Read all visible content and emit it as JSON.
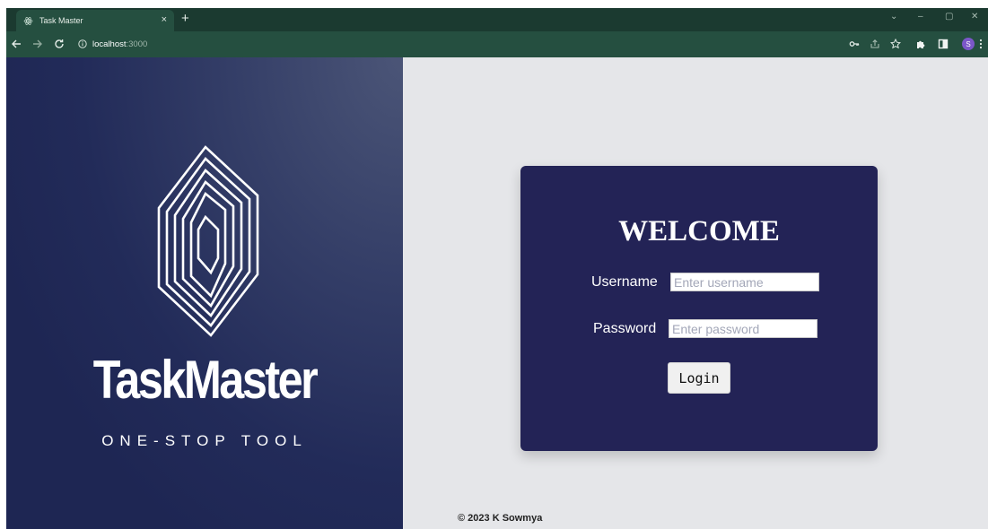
{
  "browser": {
    "tab_title": "Task Master",
    "tab_close": "×",
    "new_tab": "+",
    "url_host": "localhost",
    "url_port": ":3000",
    "profile_initial": "S",
    "window_controls": {
      "dropdown": "⌄",
      "minimize": "–",
      "restore": "▢",
      "close": "✕"
    },
    "icons": {
      "back": "back-arrow-icon",
      "forward": "forward-arrow-icon",
      "reload": "reload-icon",
      "site_info": "info-icon",
      "password": "key-icon",
      "share": "share-icon",
      "bookmark": "star-icon",
      "extensions": "puzzle-icon",
      "side_panel": "side-panel-icon",
      "menu": "kebab-menu-icon",
      "favicon": "react-atom-icon"
    },
    "colors": {
      "tabbar": "#1b3a30",
      "toolbar": "#254f40"
    }
  },
  "brand": {
    "name": "TaskMaster",
    "tagline": "ONE-STOP TOOL"
  },
  "login": {
    "heading": "WELCOME",
    "username_label": "Username",
    "username_placeholder": "Enter username",
    "password_label": "Password",
    "password_placeholder": "Enter password",
    "submit_label": "Login"
  },
  "footer": {
    "copyright": "© 2023 K Sowmya"
  },
  "colors": {
    "card_bg": "#232356",
    "page_bg": "#e5e6e9",
    "left_panel_dark": "#1e2653",
    "left_panel_light": "#4b5577"
  }
}
